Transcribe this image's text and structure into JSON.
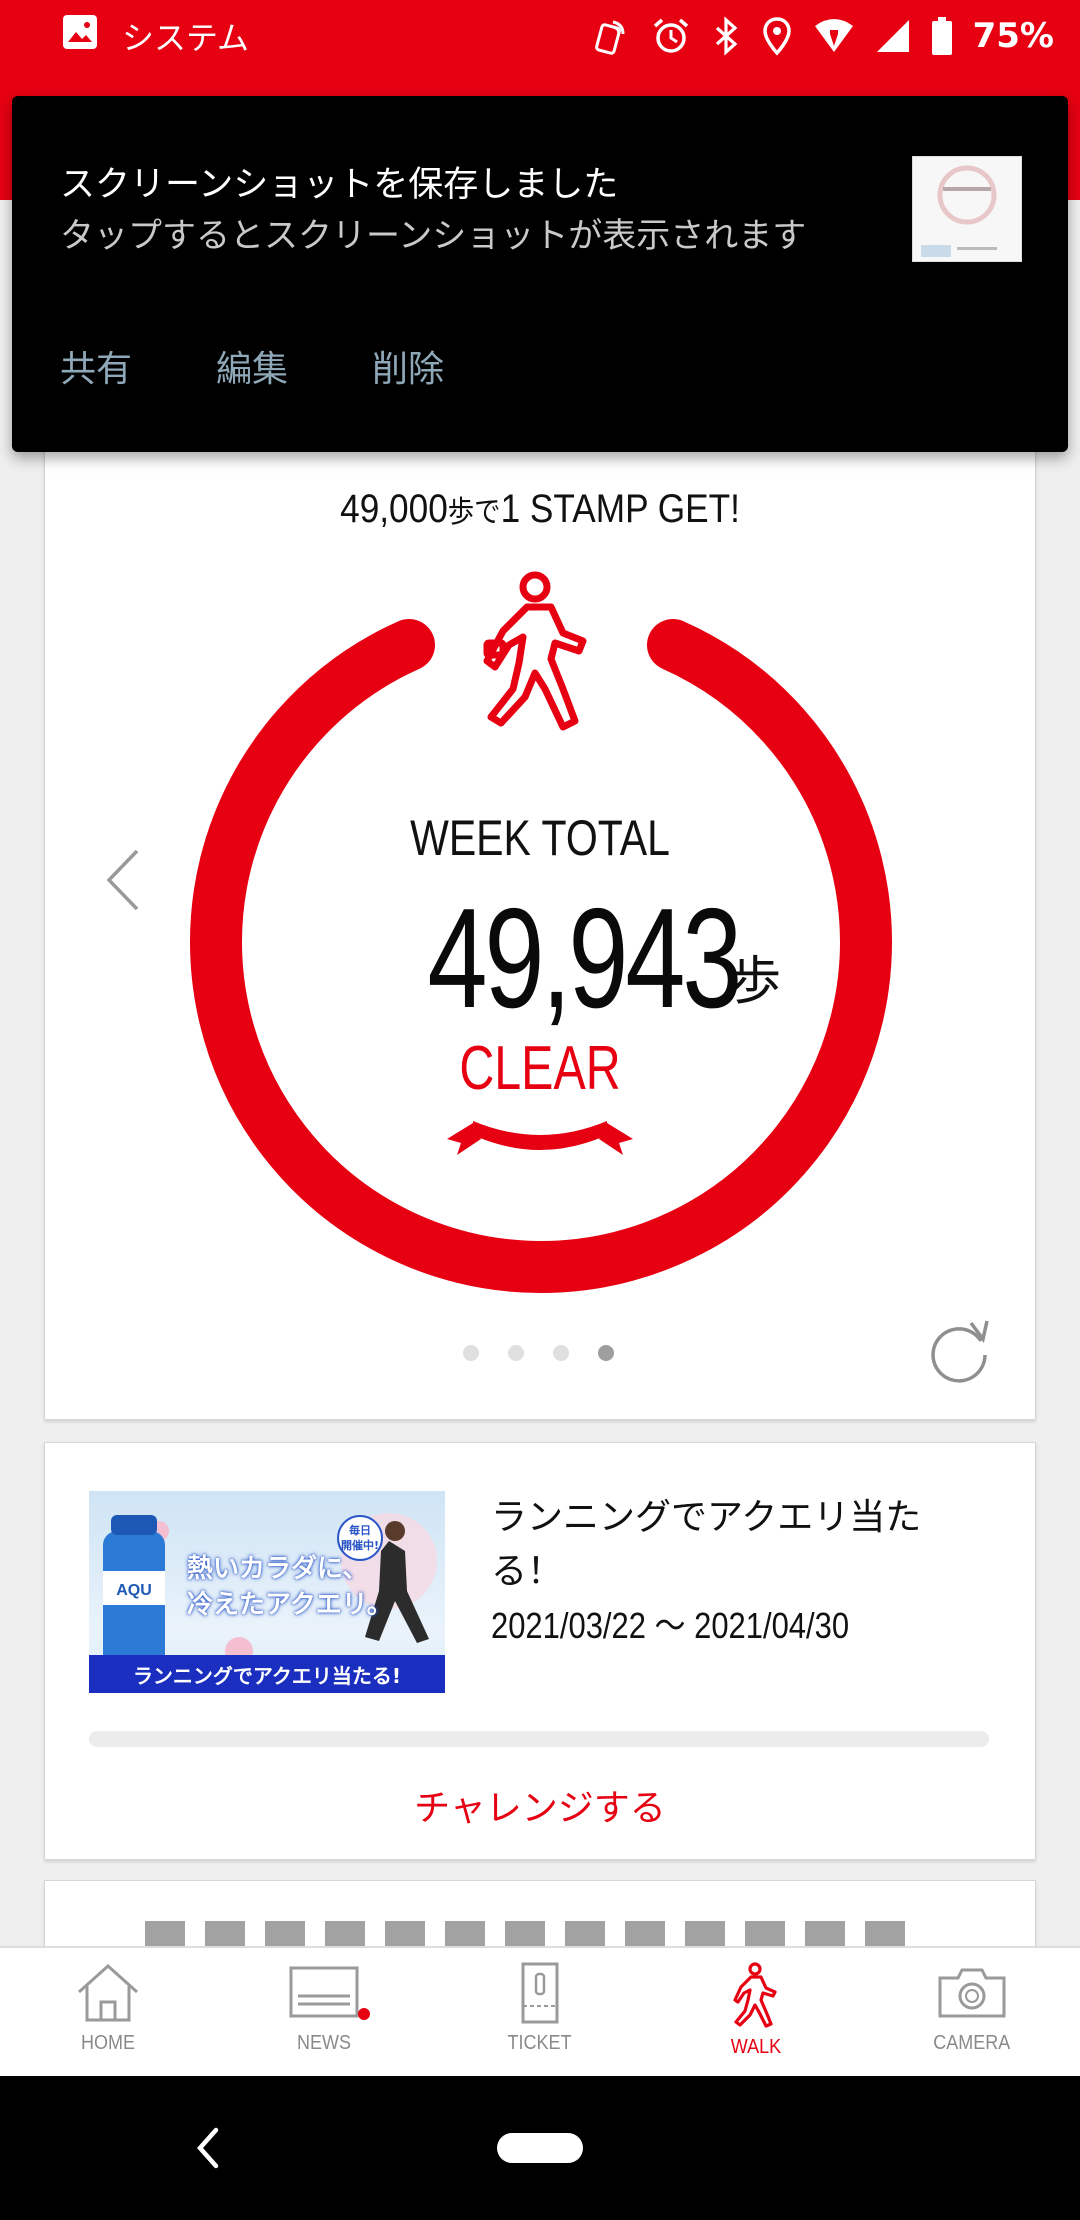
{
  "status_bar": {
    "app_name": "システム",
    "battery": "75%"
  },
  "notification": {
    "title": "スクリーンショットを保存しました",
    "text": "タップするとスクリーンショットが表示されます",
    "actions": [
      "共有",
      "編集",
      "削除"
    ]
  },
  "walk": {
    "stamp_steps": "49,000",
    "stamp_connector": "歩で",
    "stamp_suffix": "1 STAMP GET!",
    "week_total_label": "WEEK TOTAL",
    "step_count": "49,943",
    "step_unit": "歩",
    "status": "CLEAR",
    "page_count": 4,
    "active_page": 4
  },
  "news_card": {
    "banner_headline_line1": "熱いカラダに、",
    "banner_headline_line2": "冷えたアクエリ。",
    "banner_badge": "毎日\n開催中!",
    "banner_footer": "ランニングでアクエリ当たる!",
    "title": "ランニングでアクエリ当たる！",
    "period": "2021/03/22 〜 2021/04/30",
    "progress": 0,
    "cta": "チャレンジする"
  },
  "bottom_nav": {
    "items": [
      {
        "label": "HOME",
        "icon": "home-icon"
      },
      {
        "label": "NEWS",
        "icon": "news-icon"
      },
      {
        "label": "TICKET",
        "icon": "ticket-icon"
      },
      {
        "label": "WALK",
        "icon": "walk-icon"
      },
      {
        "label": "CAMERA",
        "icon": "camera-icon"
      }
    ],
    "active": "WALK"
  },
  "colors": {
    "brand_red": "#e60012",
    "notification_bg": "#000000",
    "inactive_gray": "#8a8a8a"
  }
}
